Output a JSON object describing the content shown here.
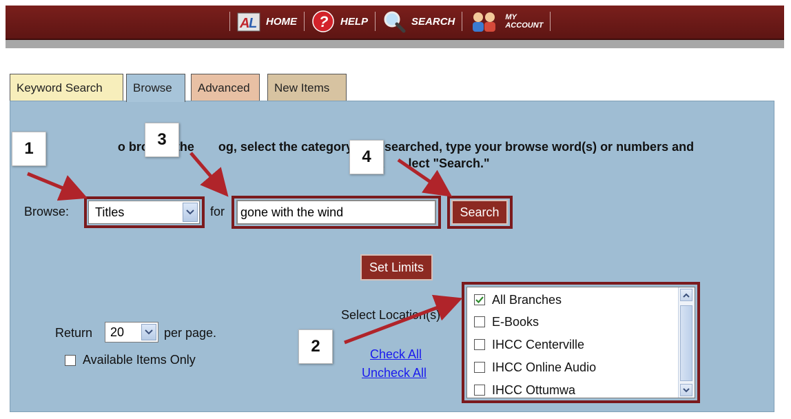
{
  "nav": {
    "items": [
      {
        "label": "HOME",
        "icon": "home-icon"
      },
      {
        "label": "HELP",
        "icon": "help-icon"
      },
      {
        "label": "SEARCH",
        "icon": "search-icon"
      },
      {
        "label_line1": "MY",
        "label_line2": "ACCOUNT",
        "icon": "account-icon"
      }
    ]
  },
  "tabs": [
    {
      "label": "Keyword Search"
    },
    {
      "label": "Browse"
    },
    {
      "label": "Advanced"
    },
    {
      "label": "New Items"
    }
  ],
  "instructions": {
    "line1": "o browse the       og, select the category t       searched, type your browse word(s) or numbers and",
    "line2": "click       lect \"Search.\""
  },
  "browse": {
    "label": "Browse:",
    "category_value": "Titles",
    "for_label": "for",
    "query_value": "gone with the wind",
    "search_button": "Search",
    "set_limits_button": "Set Limits"
  },
  "results": {
    "return_label": "Return",
    "per_page_value": "20",
    "per_page_label": "per page.",
    "available_only_label": "Available Items Only"
  },
  "location": {
    "label": "Select Location(s):",
    "check_all": "Check All",
    "uncheck_all": "Uncheck All",
    "options": [
      {
        "label": "All Branches",
        "checked": true
      },
      {
        "label": "E-Books",
        "checked": false
      },
      {
        "label": "IHCC Centerville",
        "checked": false
      },
      {
        "label": "IHCC Online Audio",
        "checked": false
      },
      {
        "label": "IHCC Ottumwa",
        "checked": false
      }
    ]
  },
  "callouts": {
    "c1": "1",
    "c2": "2",
    "c3": "3",
    "c4": "4"
  },
  "colors": {
    "nav_bg": "#6b1a18",
    "panel_bg": "#9fbdd3",
    "highlight_box": "#7b1a1d",
    "button_red": "#8c2a22",
    "tab_keyword": "#f7eebb",
    "tab_browse": "#a7c4d9",
    "tab_advanced": "#e8c0a4",
    "tab_new_items": "#d7c3a1"
  }
}
